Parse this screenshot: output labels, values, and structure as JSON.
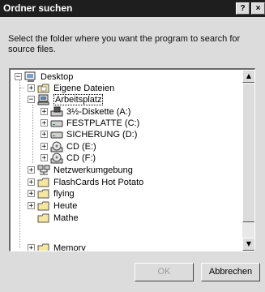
{
  "window": {
    "title": "Ordner suchen",
    "help_label": "?",
    "close_label": "×"
  },
  "description": "Select the folder where you want the program to search for source files.",
  "tree": {
    "items": [
      {
        "label": "Desktop",
        "expander": "−",
        "icon": "desktop-icon"
      },
      {
        "label": "Eigene Dateien",
        "expander": "+",
        "icon": "documents-folder-icon"
      },
      {
        "label": "Arbeitsplatz",
        "expander": "−",
        "icon": "computer-icon",
        "selected": true
      },
      {
        "label": "3½-Diskette (A:)",
        "expander": "+",
        "icon": "floppy-drive-icon"
      },
      {
        "label": "FESTPLATTE (C:)",
        "expander": "+",
        "icon": "hard-drive-icon"
      },
      {
        "label": "SICHERUNG (D:)",
        "expander": "+",
        "icon": "hard-drive-icon"
      },
      {
        "label": "CD (E:)",
        "expander": "+",
        "icon": "cd-drive-icon"
      },
      {
        "label": "CD (F:)",
        "expander": "+",
        "icon": "cd-drive-icon"
      },
      {
        "label": "Netzwerkumgebung",
        "expander": "+",
        "icon": "network-icon"
      },
      {
        "label": "FlashCards Hot Potato",
        "expander": "+",
        "icon": "folder-icon"
      },
      {
        "label": "flying",
        "expander": "+",
        "icon": "folder-icon"
      },
      {
        "label": "Heute",
        "expander": "+",
        "icon": "folder-icon"
      },
      {
        "label": "Mathe",
        "expander": "",
        "icon": "folder-icon"
      },
      {
        "label": "Memory",
        "expander": "+",
        "icon": "folder-icon"
      }
    ]
  },
  "buttons": {
    "ok_label": "OK",
    "cancel_label": "Abbrechen"
  },
  "colors": {
    "titlebar": "#1e1e1e",
    "dialog_bg": "#dcdcdc",
    "folder": "#f6e7a0"
  }
}
